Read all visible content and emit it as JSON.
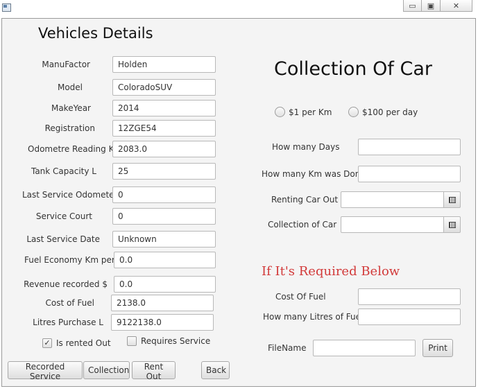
{
  "left": {
    "title": "Vehicles Details",
    "fields": [
      {
        "label": "ManuFactor",
        "value": "Holden"
      },
      {
        "label": "Model",
        "value": "ColoradoSUV"
      },
      {
        "label": "MakeYear",
        "value": "2014"
      },
      {
        "label": "Registration",
        "value": "12ZGE54"
      },
      {
        "label": "Odometre Reading Km",
        "value": "2083.0"
      },
      {
        "label": "Tank Capacity L",
        "value": "25"
      },
      {
        "label": "Last Service Odometer",
        "value": "0"
      },
      {
        "label": "Service Court",
        "value": "0"
      },
      {
        "label": "Last Service Date",
        "value": "Unknown"
      },
      {
        "label": "Fuel Economy Km per L",
        "value": "0.0"
      },
      {
        "label": "Revenue recorded $",
        "value": "0.0"
      },
      {
        "label": "Cost of Fuel",
        "value": "2138.0"
      },
      {
        "label": "Litres Purchase L",
        "value": "9122138.0"
      }
    ],
    "is_rented_label": "Is rented Out",
    "is_rented_checked": true,
    "requires_service_label": "Requires Service",
    "requires_service_checked": false
  },
  "right": {
    "title": "Collection Of Car",
    "radio_per_km": "$1 per Km",
    "radio_per_day": "$100 per day",
    "how_many_days_label": "How many Days",
    "how_many_days_value": "",
    "km_done_label": "How many Km was Done",
    "km_done_value": "",
    "renting_out_label": "Renting Car Out",
    "renting_out_value": "",
    "collection_label": "Collection of Car",
    "collection_value": "",
    "required_heading": "If It's Required Below",
    "cost_fuel_label": "Cost Of Fuel",
    "cost_fuel_value": "",
    "litres_fuel_label": "How many Litres of Fuel",
    "litres_fuel_value": "",
    "filename_label": "FileName",
    "filename_value": "",
    "print_label": "Print"
  },
  "buttons": {
    "recorded_service": "Recorded Service",
    "collection": "Collection",
    "rent_out": "Rent Out",
    "back": "Back"
  },
  "window": {
    "minimize": "▭",
    "maximize": "▣",
    "close": "✕"
  },
  "colors": {
    "required_heading": "#d23a3a",
    "window_bg": "#f4f4f4"
  }
}
